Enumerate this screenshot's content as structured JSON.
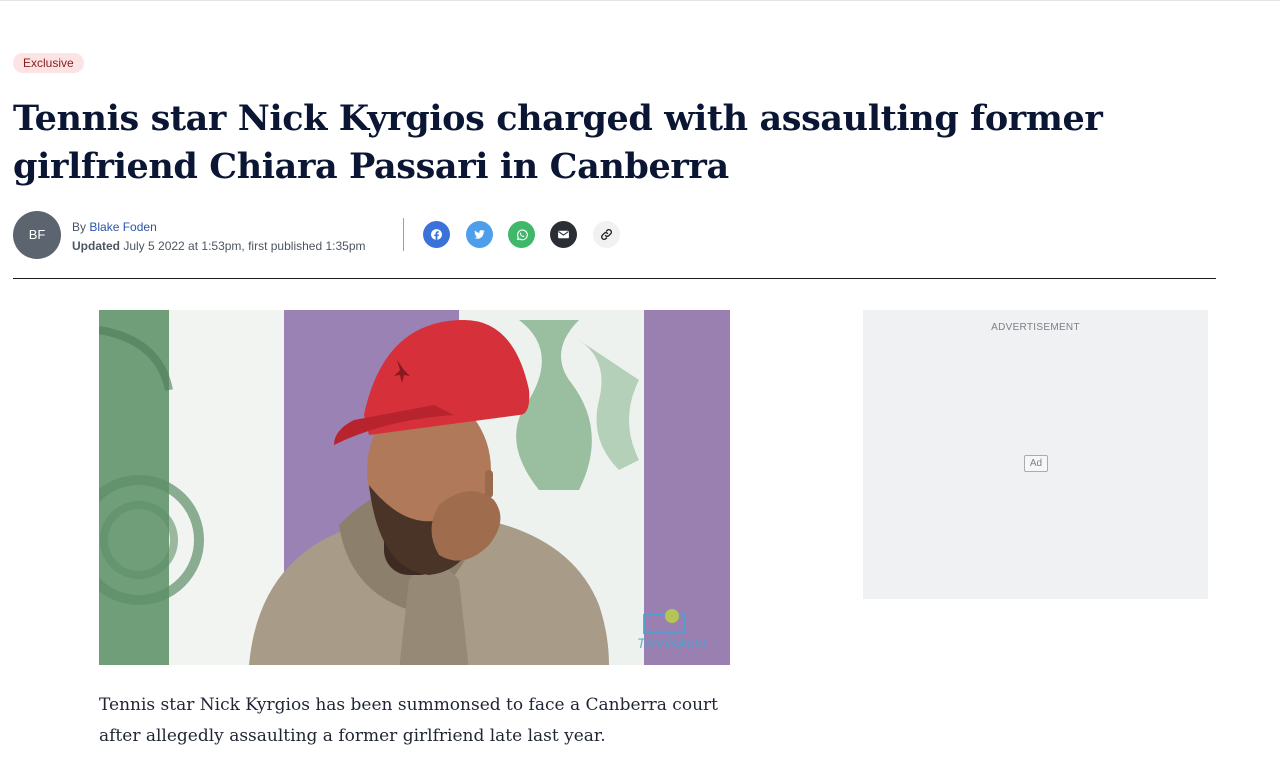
{
  "article": {
    "badge": "Exclusive",
    "headline": "Tennis star Nick Kyrgios charged with assaulting former girlfriend Chiara Passari in Canberra",
    "author_initials": "BF",
    "byline_prefix": "By",
    "author": "Blake Foden",
    "updated_label": "Updated",
    "updated_text": "July 5 2022 at 1:53pm, first published 1:35pm",
    "lede": "Tennis star Nick Kyrgios has been summonsed to face a Canberra court after allegedly assaulting a former girlfriend late last year.",
    "image_watermark": "TennisActu"
  },
  "share": {
    "icons": [
      "facebook-icon",
      "twitter-icon",
      "whatsapp-icon",
      "email-icon",
      "link-icon"
    ],
    "colors": {
      "facebook": "#3a72d9",
      "twitter": "#4d9fec",
      "whatsapp": "#3fb86a",
      "email": "#2a2f36",
      "link": "#f1f1f1"
    }
  },
  "ad": {
    "label": "ADVERTISEMENT",
    "mark": "Ad"
  }
}
